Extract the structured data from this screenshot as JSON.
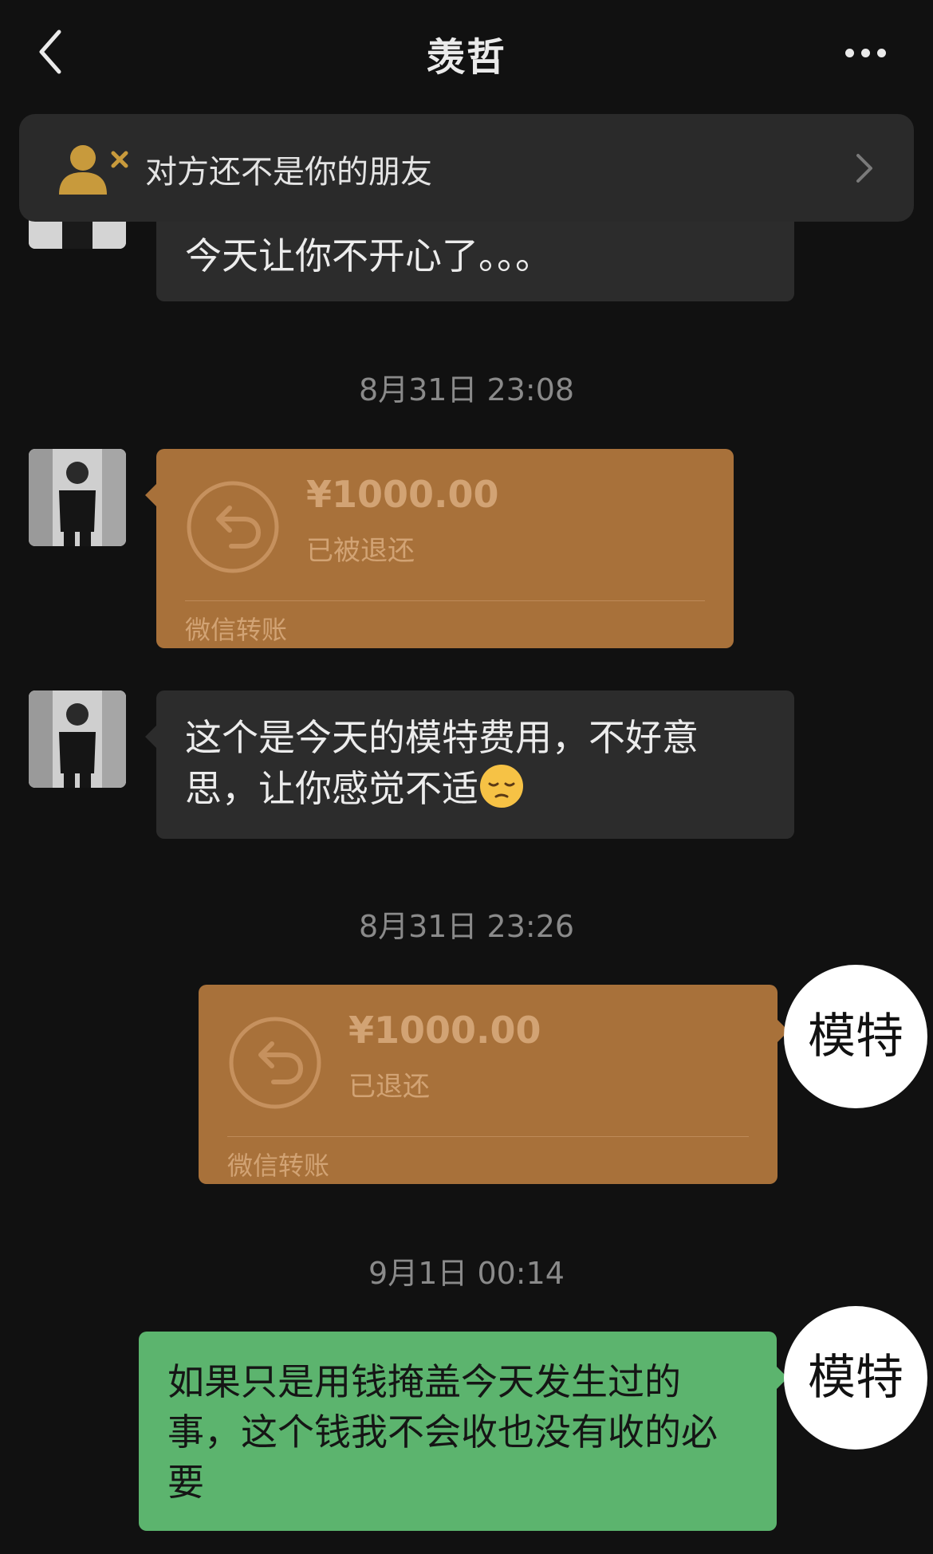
{
  "header": {
    "title": "羡哲"
  },
  "banner": {
    "text": "对方还不是你的朋友",
    "icon": "user-remove-icon"
  },
  "messages": {
    "m0": {
      "text": "今天让你不开心了。。。"
    },
    "t1": "8月31日 23:08",
    "transfer1": {
      "amount": "¥1000.00",
      "status": "已被退还",
      "footer": "微信转账"
    },
    "m2": {
      "text": "这个是今天的模特费用，不好意思，让你感觉不适"
    },
    "t2": "8月31日 23:26",
    "transfer2": {
      "amount": "¥1000.00",
      "status": "已退还",
      "footer": "微信转账",
      "label": "模特"
    },
    "t3": "9月1日 00:14",
    "m3": {
      "text": "如果只是用钱掩盖今天发生过的事，这个钱我不会收也没有收的必要",
      "label": "模特"
    }
  },
  "colors": {
    "background": "#111111",
    "bubble_gray": "#2c2c2c",
    "bubble_green": "#5cb46e",
    "transfer_orange": "#a8713a"
  }
}
